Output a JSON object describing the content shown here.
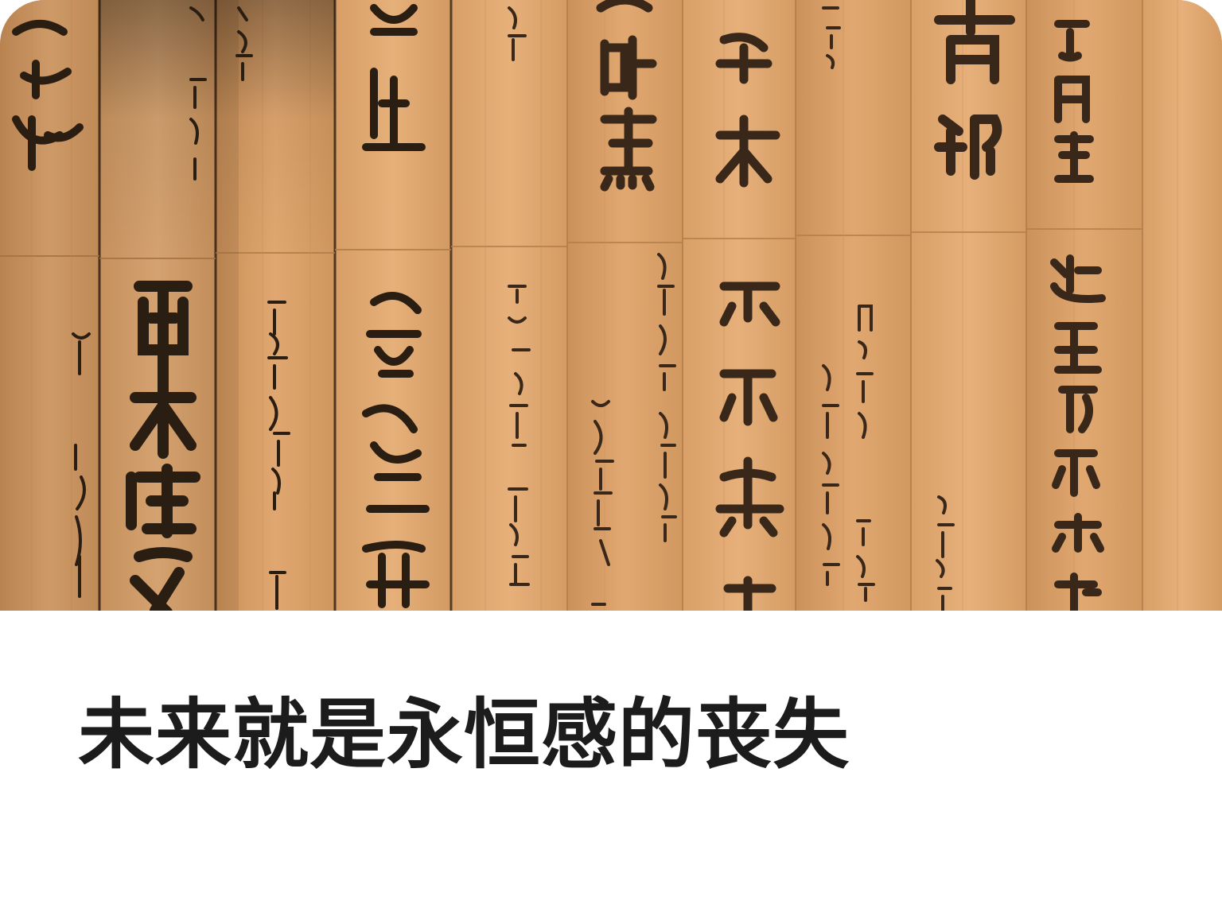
{
  "card": {
    "title": "未来就是永恒感的丧失",
    "image_alt": "wooden-slats-with-chinese-calligraphy"
  },
  "colors": {
    "wood_light": "#e2aa72",
    "wood_mid": "#d49b62",
    "wood_dark": "#b9824d",
    "ink": "#2a1d12",
    "title_text": "#1c1c1c",
    "background": "#ffffff"
  }
}
